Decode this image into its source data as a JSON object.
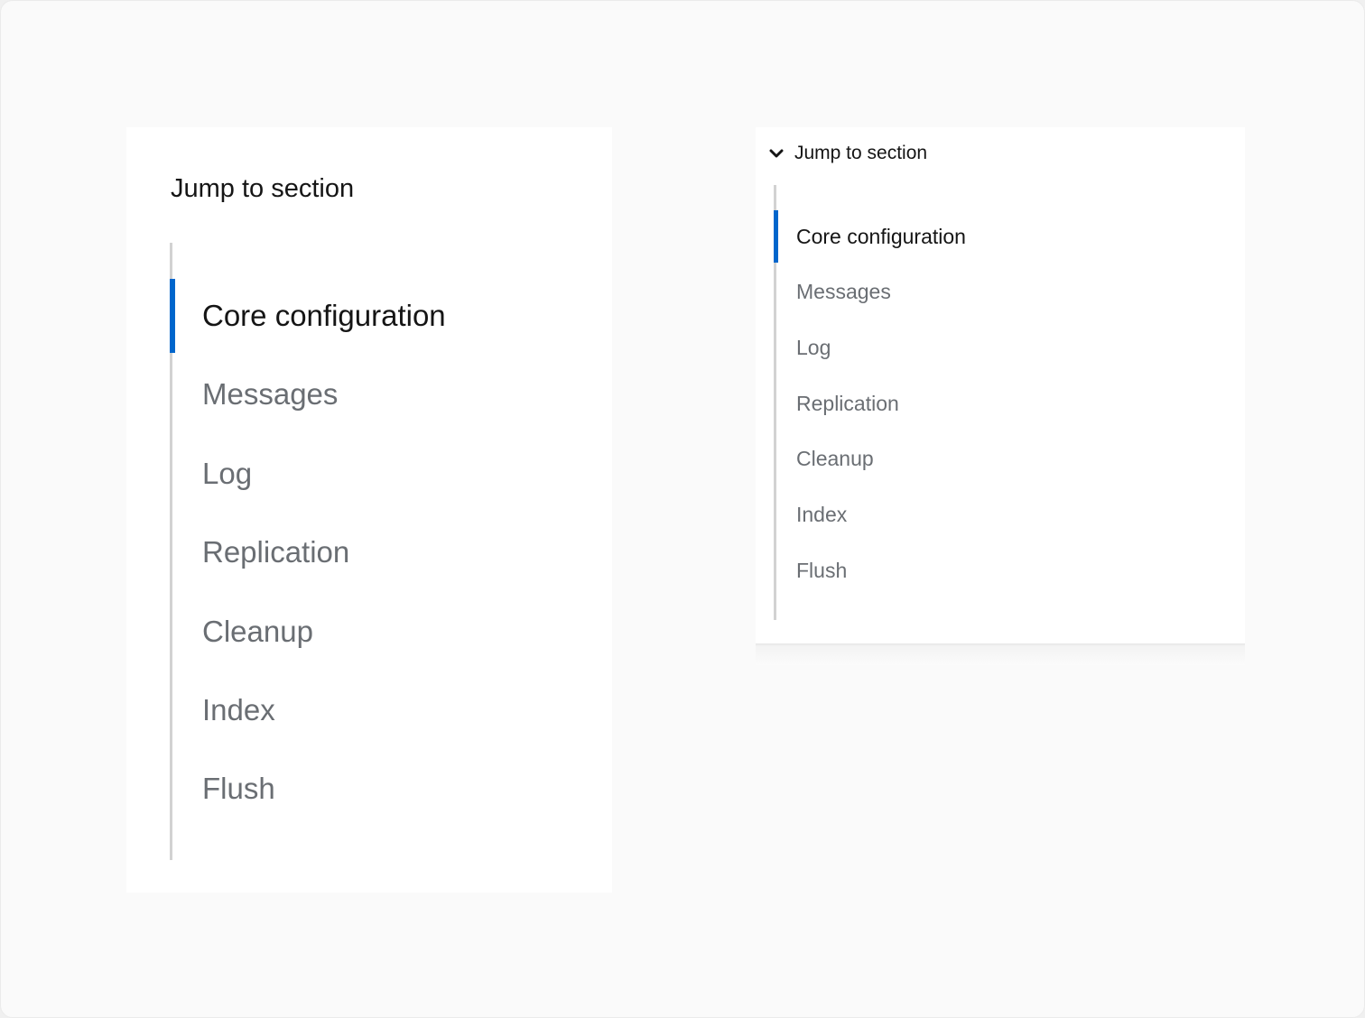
{
  "large_panel": {
    "title": "Jump to section",
    "items": [
      {
        "label": "Core configuration",
        "current": true
      },
      {
        "label": "Messages",
        "current": false
      },
      {
        "label": "Log",
        "current": false
      },
      {
        "label": "Replication",
        "current": false
      },
      {
        "label": "Cleanup",
        "current": false
      },
      {
        "label": "Index",
        "current": false
      },
      {
        "label": "Flush",
        "current": false
      }
    ]
  },
  "small_panel": {
    "toggle_label": "Jump to section",
    "toggle_icon": "chevron-down-icon",
    "expanded": true,
    "items": [
      {
        "label": "Core configuration",
        "current": true
      },
      {
        "label": "Messages",
        "current": false
      },
      {
        "label": "Log",
        "current": false
      },
      {
        "label": "Replication",
        "current": false
      },
      {
        "label": "Cleanup",
        "current": false
      },
      {
        "label": "Index",
        "current": false
      },
      {
        "label": "Flush",
        "current": false
      }
    ]
  },
  "colors": {
    "accent": "#0066cc",
    "text_current": "#151515",
    "text_muted": "#6a6e73",
    "rail": "#d2d2d2"
  }
}
